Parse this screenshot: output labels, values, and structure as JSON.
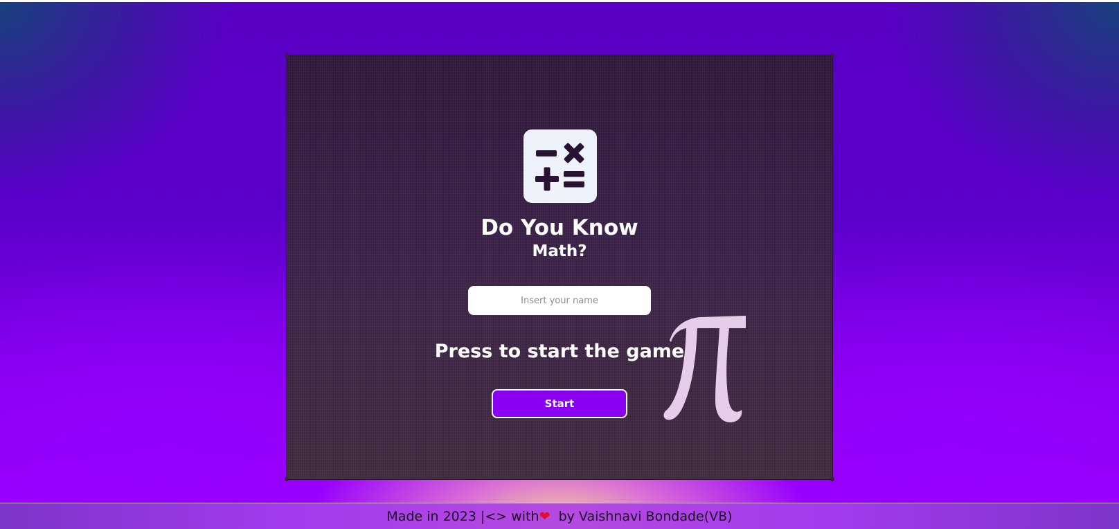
{
  "game": {
    "title": "Do You Know",
    "subtitle": "Math?",
    "name_input": {
      "placeholder": "Insert your name",
      "value": ""
    },
    "prompt": "Press to start the game",
    "start_label": "Start",
    "logo_icon": "calculator-symbols-icon",
    "decoration_icon": "pi-icon",
    "colors": {
      "button_bg": "#8a00f0",
      "logo_tile": "#eef2fb",
      "logo_glyph": "#2a1233",
      "pi_fill": "#e6cdea"
    }
  },
  "footer": {
    "text_before_heart": "Made in 2023 |<> with",
    "heart_icon": "heart-icon",
    "heart_glyph": "❤",
    "text_after_heart": "  by Vaishnavi Bondade(VB)"
  }
}
